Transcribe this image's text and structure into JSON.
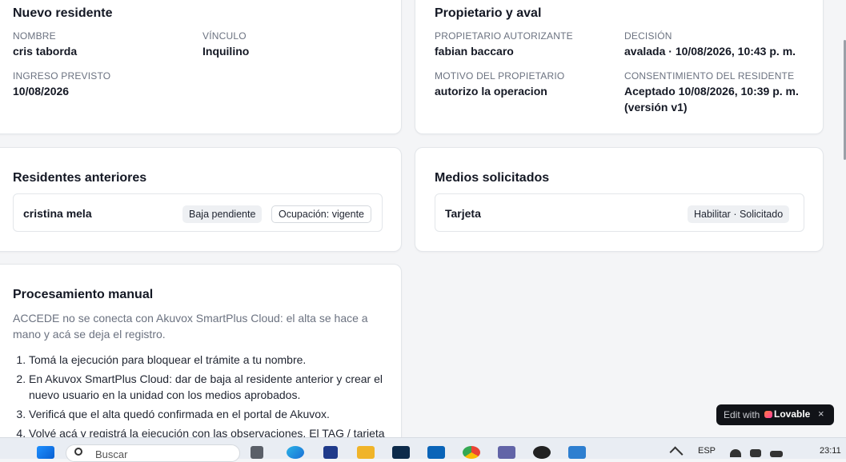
{
  "nuevo_residente": {
    "title": "Nuevo residente",
    "nombre_label": "NOMBRE",
    "nombre_value": "cris taborda",
    "vinculo_label": "VÍNCULO",
    "vinculo_value": "Inquilino",
    "ingreso_label": "INGRESO PREVISTO",
    "ingreso_value": "10/08/2026"
  },
  "propietario_aval": {
    "title": "Propietario y aval",
    "propietario_label": "PROPIETARIO AUTORIZANTE",
    "propietario_value": "fabian baccaro",
    "decision_label": "DECISIÓN",
    "decision_value": "avalada · 10/08/2026, 10:43 p. m.",
    "motivo_label": "MOTIVO DEL PROPIETARIO",
    "motivo_value": "autorizo la operacion",
    "consentimiento_label": "CONSENTIMIENTO DEL RESIDENTE",
    "consentimiento_value_line1": "Aceptado 10/08/2026, 10:39 p. m.",
    "consentimiento_value_line2": "(versión v1)"
  },
  "residentes_anteriores": {
    "title": "Residentes anteriores",
    "items": [
      {
        "name": "cristina mela",
        "badge1": "Baja pendiente",
        "badge2": "Ocupación: vigente"
      }
    ]
  },
  "medios_solicitados": {
    "title": "Medios solicitados",
    "items": [
      {
        "name": "Tarjeta",
        "badge": "Habilitar · Solicitado"
      }
    ]
  },
  "procesamiento_manual": {
    "title": "Procesamiento manual",
    "description_line1": "ACCEDE no se conecta con Akuvox SmartPlus Cloud: el alta se hace a",
    "description_line2": "mano y acá se deja el registro.",
    "steps": [
      "Tomá la ejecución para bloquear el trámite a tu nombre.",
      "En Akuvox SmartPlus Cloud: dar de baja al residente anterior y crear el nuevo usuario en la unidad con los medios aprobados.",
      "Verificá que el alta quedó confirmada en el portal de Akuvox.",
      "Volvé acá y registrá la ejecución con las observaciones. El TAG / tarjeta"
    ]
  },
  "lovable_badge": {
    "edit_text": "Edit with",
    "brand_text": "Lovable",
    "close_glyph": "×"
  },
  "taskbar": {
    "search_placeholder": "Buscar",
    "language": "ESP",
    "time": "23:11"
  },
  "colors": {
    "page_bg": "#f4f5f7",
    "card_bg": "#ffffff",
    "accent_lovable": "#ff5a7a"
  }
}
